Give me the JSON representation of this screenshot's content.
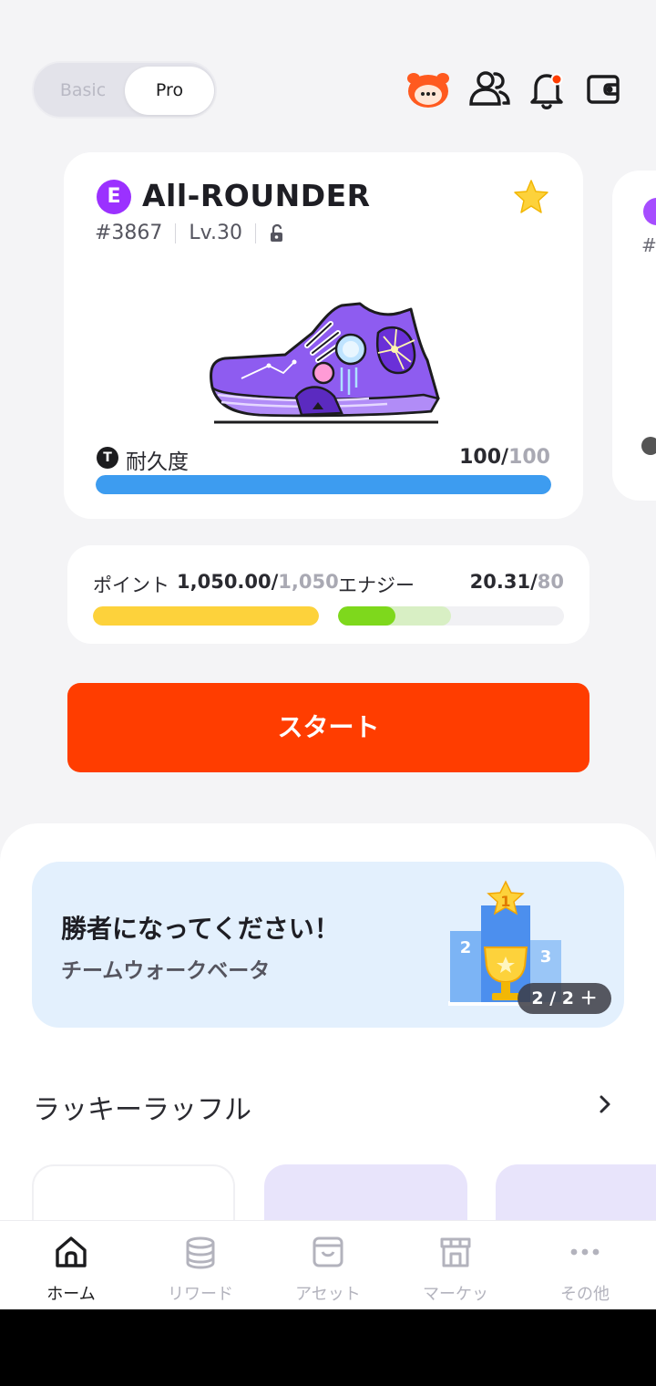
{
  "header": {
    "mode_options": [
      "Basic",
      "Pro"
    ],
    "selected_mode": "Pro",
    "icons": [
      "mascot-icon",
      "friends-icon",
      "bell-icon",
      "wallet-icon"
    ]
  },
  "shoe_card": {
    "rarity": "E",
    "name": "All-ROUNDER",
    "id": "#3867",
    "level": "Lv.30",
    "durability_label": "耐久度",
    "durability_value": "100/",
    "durability_max": "100",
    "durability_fraction": 1.0
  },
  "peek_card": {
    "hash": "#"
  },
  "stats": {
    "points_label": "ポイント",
    "points_value": "1,050.00/",
    "points_max": "1,050",
    "points_fraction": 1.0,
    "energy_label": "エナジー",
    "energy_value": "20.31/",
    "energy_max": "80",
    "energy_fraction": 0.254,
    "energy_shade_fraction": 0.5
  },
  "start_button": "スタート",
  "banner": {
    "title": "勝者になってください！",
    "subtitle": "チームウォークベータ",
    "counter": "2 / 2 ＋",
    "podium_ranks": [
      "1",
      "2",
      "3"
    ]
  },
  "raffle": {
    "title": "ラッキーラッフル"
  },
  "bottom_nav": {
    "items": [
      {
        "label": "ホーム",
        "icon": "home-icon",
        "active": true
      },
      {
        "label": "リワード",
        "icon": "coins-icon",
        "active": false
      },
      {
        "label": "アセット",
        "icon": "box-icon",
        "active": false
      },
      {
        "label": "マーケッ",
        "icon": "store-icon",
        "active": false
      },
      {
        "label": "その他",
        "icon": "more-icon",
        "active": false
      }
    ]
  },
  "colors": {
    "accent": "#ff3d00",
    "rarity_epic": "#9b31ff",
    "durability_bar": "#3d9cf0",
    "points_bar": "#fdd23b",
    "energy_bar": "#7ed81c",
    "energy_bar_track": "#d8efc4",
    "banner_bg": "#e3f0fd"
  }
}
